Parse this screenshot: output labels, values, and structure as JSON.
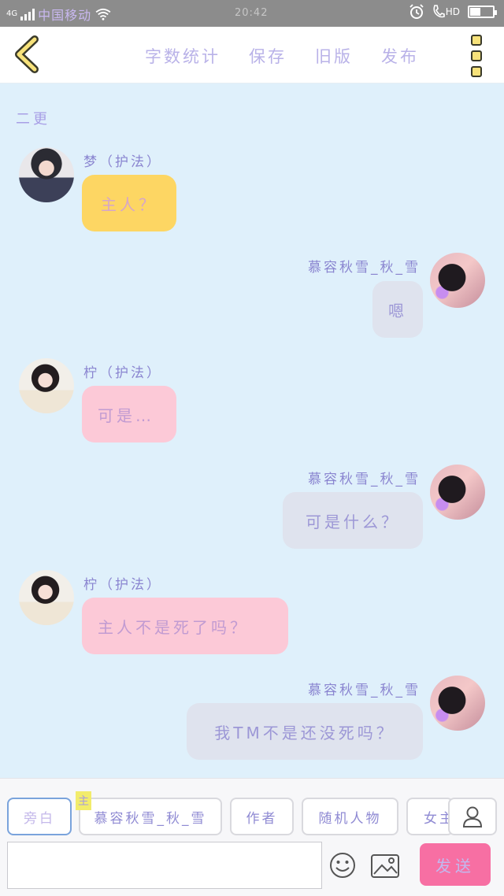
{
  "status_bar": {
    "network": "4G",
    "carrier": "中国移动",
    "time": "20:42",
    "hd_label": "HD",
    "battery_level": 0.45
  },
  "top_bar": {
    "back_icon": "chevron-left-icon",
    "actions": [
      "字数统计",
      "保存",
      "旧版",
      "发布"
    ],
    "more_icon": "more-vertical-icon",
    "accent_color": "#f7e27a"
  },
  "chat": {
    "chapter_label": "二更",
    "messages": [
      {
        "side": "left",
        "name": "梦（护法）",
        "text": "主人？",
        "bubble_color": "#fdd663"
      },
      {
        "side": "right",
        "name": "慕容秋雪_秋_雪",
        "text": "嗯",
        "bubble_color": "#dfe3ee"
      },
      {
        "side": "left",
        "name": "柠（护法）",
        "text": "可是…",
        "bubble_color": "#fcc9d7"
      },
      {
        "side": "right",
        "name": "慕容秋雪_秋_雪",
        "text": "可是什么？",
        "bubble_color": "#dfe3ee"
      },
      {
        "side": "left",
        "name": "柠（护法）",
        "text": "主人不是死了吗？",
        "bubble_color": "#fcc9d7"
      },
      {
        "side": "right",
        "name": "慕容秋雪_秋_雪",
        "text": "我TM不是还没死吗？",
        "bubble_color": "#dfe3ee"
      }
    ]
  },
  "bottom": {
    "chips": [
      "旁白",
      "慕容秋雪_秋_雪",
      "作者",
      "随机人物",
      "女主"
    ],
    "active_chip": "旁白",
    "main_role_tag": "主",
    "person_icon": "person-icon",
    "input_value": "",
    "emoji_icon": "emoji-icon",
    "image_icon": "image-icon",
    "send_label": "发送",
    "send_color": "#f76fa3"
  }
}
